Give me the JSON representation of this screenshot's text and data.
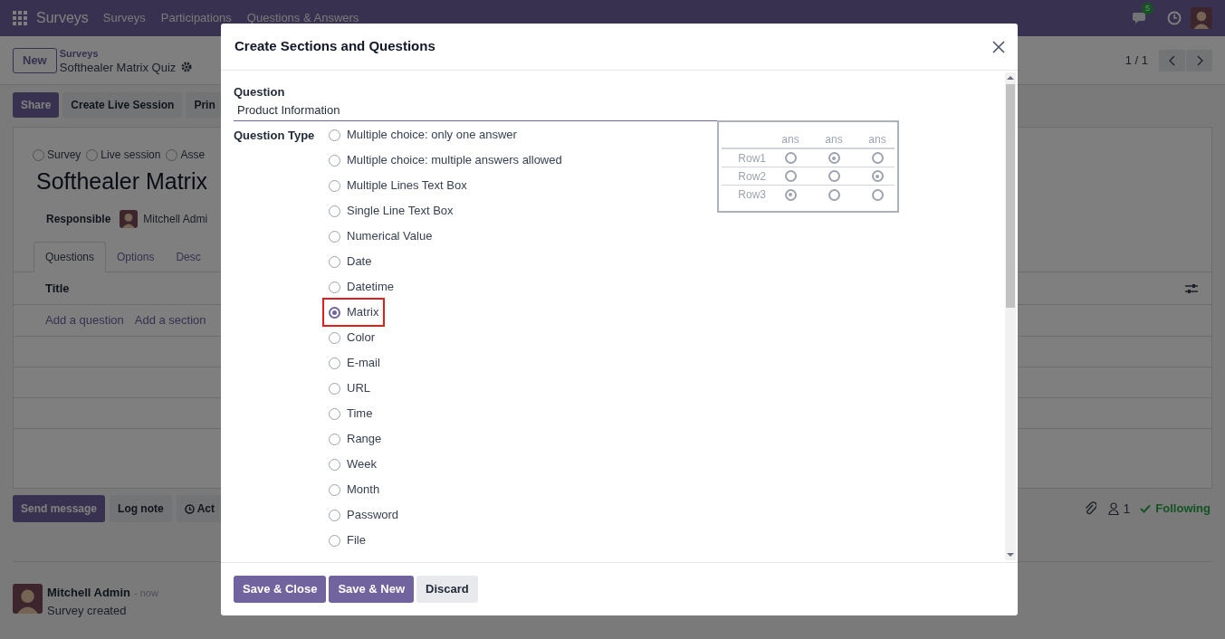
{
  "navbar": {
    "app_name": "Surveys",
    "menu": [
      "Surveys",
      "Participations",
      "Questions & Answers"
    ],
    "chat_count": "5"
  },
  "control_panel": {
    "new_button": "New",
    "breadcrumb_parent": "Surveys",
    "breadcrumb_current": "Softhealer Matrix Quiz",
    "pager": "1 / 1"
  },
  "actions": [
    {
      "label": "Share",
      "kind": "primary"
    },
    {
      "label": "Create Live Session",
      "kind": "secondary"
    },
    {
      "label": "Prin",
      "kind": "secondary"
    }
  ],
  "form": {
    "survey_types": [
      {
        "label": "Survey",
        "selected": false
      },
      {
        "label": "Live session",
        "selected": false
      },
      {
        "label": "Asse",
        "selected": false
      }
    ],
    "title": "Softhealer Matrix",
    "responsible_label": "Responsible",
    "responsible": "Mitchell Admi",
    "tabs": [
      {
        "label": "Questions",
        "selected": true
      },
      {
        "label": "Options",
        "selected": false
      },
      {
        "label": "Desc",
        "selected": false
      }
    ],
    "table": {
      "columns": [
        "Title"
      ],
      "links": [
        "Add a question",
        "Add a section"
      ]
    }
  },
  "chatter": {
    "buttons": [
      {
        "label": "Send message",
        "kind": "primary"
      },
      {
        "label": "Log note",
        "kind": "secondary"
      },
      {
        "label": "Act",
        "kind": "activity"
      }
    ],
    "followers": "1",
    "following": "Following",
    "message": {
      "author": "Mitchell Admin",
      "time": "- now",
      "body": "Survey created"
    }
  },
  "dialog": {
    "title": "Create Sections and Questions",
    "question_label": "Question",
    "question_value": "Product Information",
    "type_label": "Question Type",
    "options": [
      {
        "label": "Multiple choice: only one answer",
        "selected": false,
        "highlighted": false
      },
      {
        "label": "Multiple choice: multiple answers allowed",
        "selected": false,
        "highlighted": false
      },
      {
        "label": "Multiple Lines Text Box",
        "selected": false,
        "highlighted": false
      },
      {
        "label": "Single Line Text Box",
        "selected": false,
        "highlighted": false
      },
      {
        "label": "Numerical Value",
        "selected": false,
        "highlighted": false
      },
      {
        "label": "Date",
        "selected": false,
        "highlighted": false
      },
      {
        "label": "Datetime",
        "selected": false,
        "highlighted": false
      },
      {
        "label": "Matrix",
        "selected": true,
        "highlighted": true
      },
      {
        "label": "Color",
        "selected": false,
        "highlighted": false
      },
      {
        "label": "E-mail",
        "selected": false,
        "highlighted": false
      },
      {
        "label": "URL",
        "selected": false,
        "highlighted": false
      },
      {
        "label": "Time",
        "selected": false,
        "highlighted": false
      },
      {
        "label": "Range",
        "selected": false,
        "highlighted": false
      },
      {
        "label": "Week",
        "selected": false,
        "highlighted": false
      },
      {
        "label": "Month",
        "selected": false,
        "highlighted": false
      },
      {
        "label": "Password",
        "selected": false,
        "highlighted": false
      },
      {
        "label": "File",
        "selected": false,
        "highlighted": false
      }
    ],
    "preview": {
      "columns": [
        "ans",
        "ans",
        "ans"
      ],
      "rows": [
        {
          "label": "Row1",
          "choices": [
            {
              "selected": false
            },
            {
              "selected": true
            },
            {
              "selected": false
            }
          ]
        },
        {
          "label": "Row2",
          "choices": [
            {
              "selected": false
            },
            {
              "selected": false
            },
            {
              "selected": true
            }
          ]
        },
        {
          "label": "Row3",
          "choices": [
            {
              "selected": true
            },
            {
              "selected": false
            },
            {
              "selected": false
            }
          ]
        }
      ]
    },
    "buttons": [
      {
        "label": "Save & Close",
        "kind": "primary"
      },
      {
        "label": "Save & New",
        "kind": "primary"
      },
      {
        "label": "Discard",
        "kind": "secondary"
      }
    ]
  }
}
